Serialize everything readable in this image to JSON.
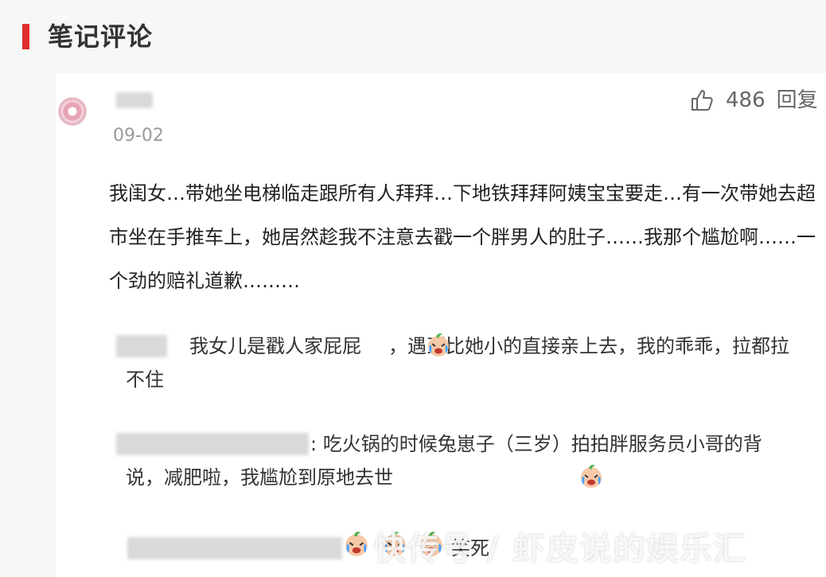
{
  "section": {
    "title": "笔记评论"
  },
  "comment": {
    "date": "09-02",
    "like_count": "486",
    "reply_label": "回复",
    "text": "我闺女…带她坐电梯临走跟所有人拜拜…下地铁拜拜阿姨宝宝要走…有一次带她去超市坐在手推车上，她居然趁我不注意去戳一个胖男人的肚子……我那个尴尬啊……一个劲的赔礼道歉………"
  },
  "replies": [
    {
      "text_before_emoji": "我女儿是戳人家屁屁",
      "text_after_emoji": "，遇到比她小的直接亲上去，我的乖乖，拉都拉不住",
      "emoji": "crying-laugh-emoji"
    },
    {
      "text_before_emoji": ": 吃火锅的时候兔崽子（三岁）拍拍胖服务员小哥的背说，减肥啦，我尴尬到原地去世",
      "emoji": "crying-laugh-emoji"
    },
    {
      "text": "笑死",
      "emoji": "crying-laugh-emoji"
    }
  ],
  "watermark": "快传号 / 虾皮说的娱乐汇",
  "colors": {
    "accent": "#e02d2d",
    "background": "#f7f7f7",
    "card": "#ffffff",
    "muted": "#999999"
  }
}
